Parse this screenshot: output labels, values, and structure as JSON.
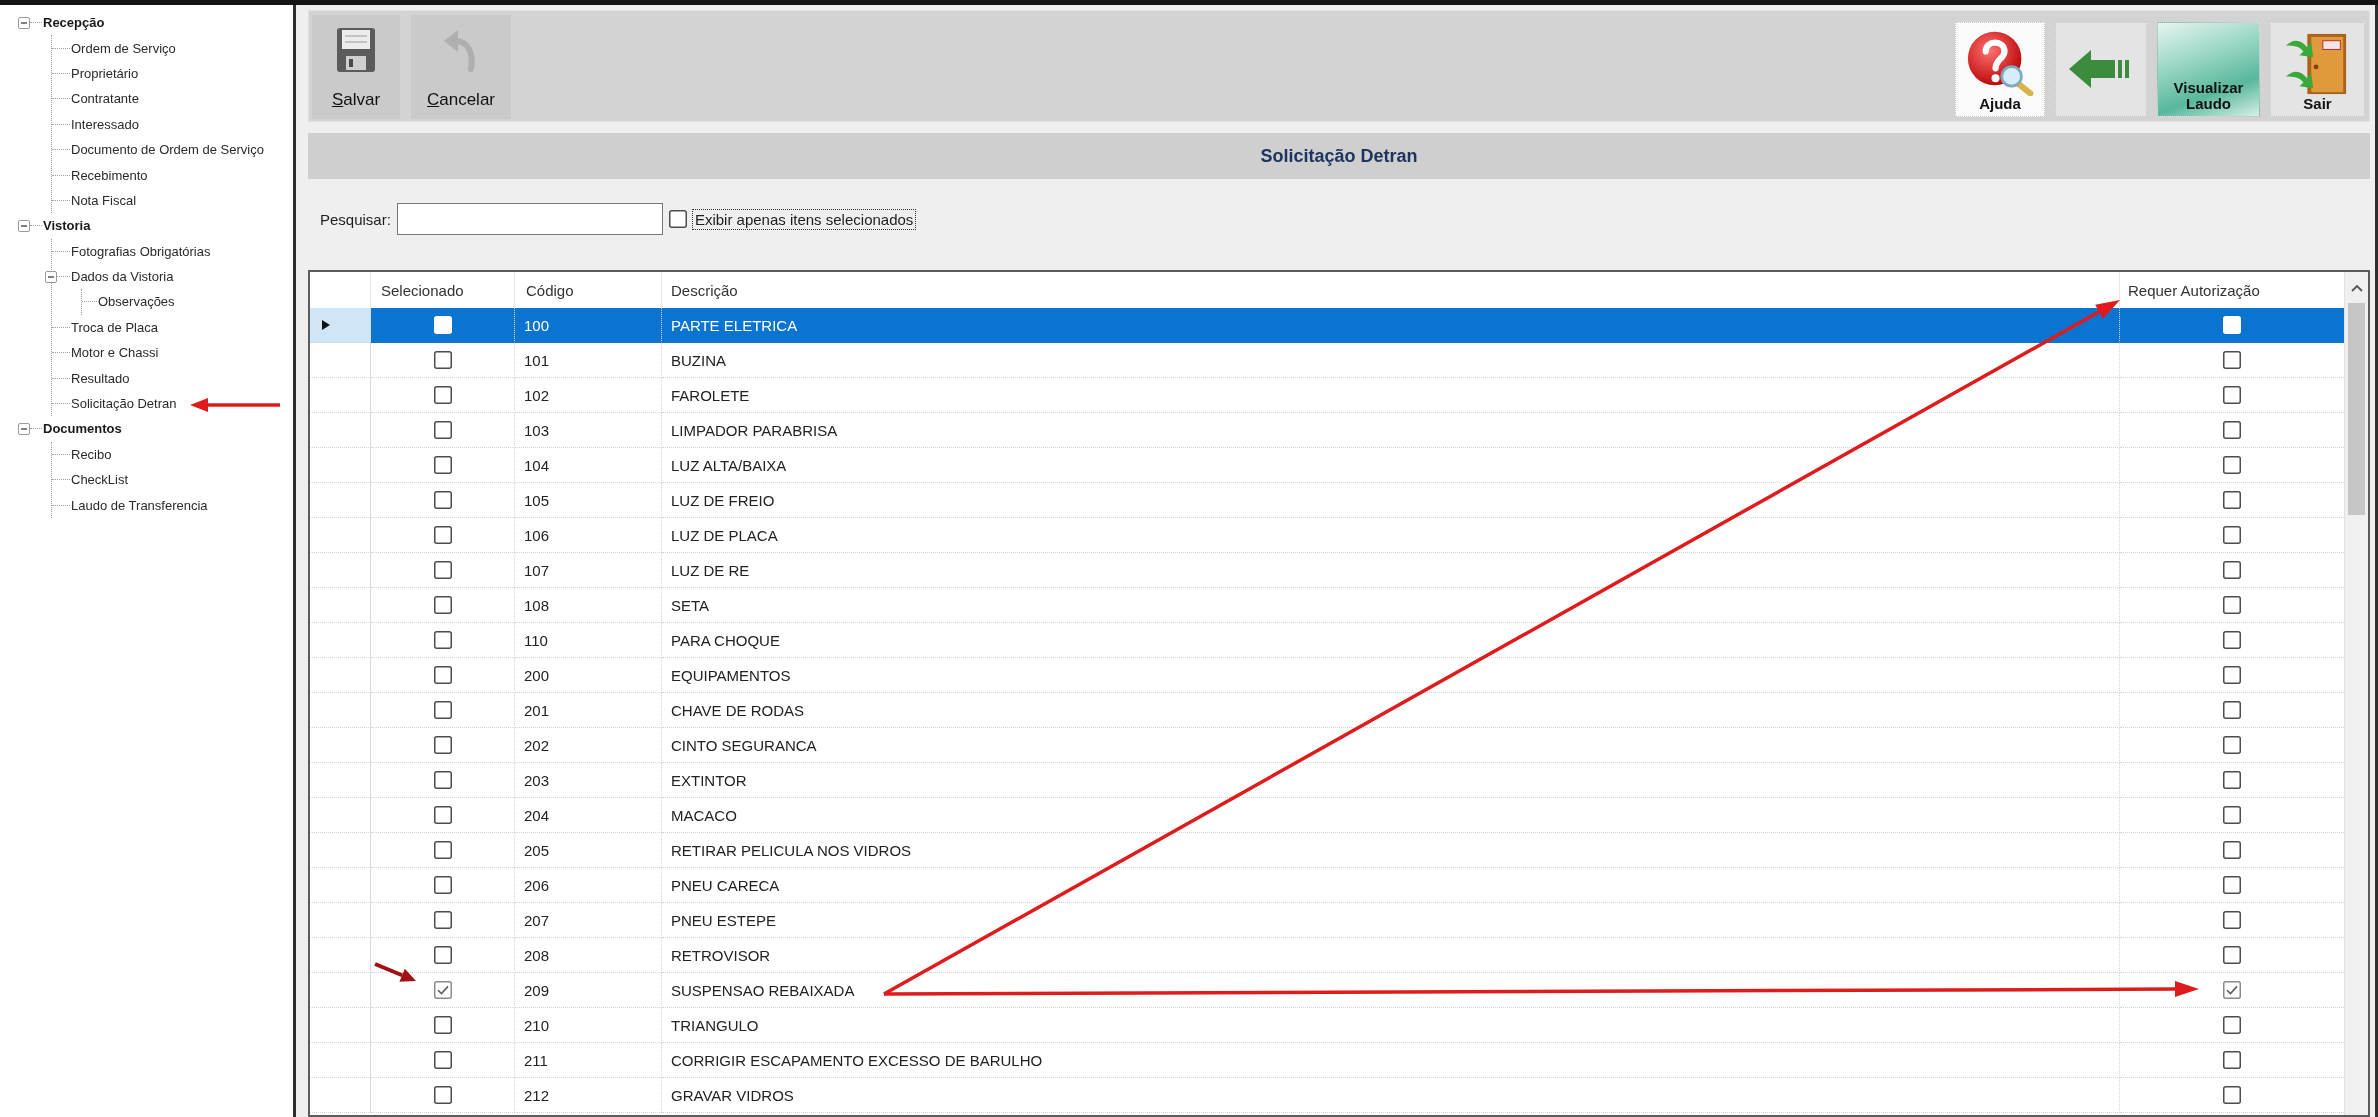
{
  "sidebar": {
    "tree": [
      {
        "label": "Recepção",
        "expanded": true,
        "children": [
          {
            "label": "Ordem de Serviço"
          },
          {
            "label": "Proprietário"
          },
          {
            "label": "Contratante"
          },
          {
            "label": "Interessado"
          },
          {
            "label": "Documento de Ordem de Serviço"
          },
          {
            "label": "Recebimento"
          },
          {
            "label": "Nota Fiscal"
          }
        ]
      },
      {
        "label": "Vistoria",
        "expanded": true,
        "children": [
          {
            "label": "Fotografias Obrigatórias"
          },
          {
            "label": "Dados da Vistoria",
            "expanded": true,
            "children": [
              {
                "label": "Observações"
              }
            ]
          },
          {
            "label": "Troca de Placa"
          },
          {
            "label": "Motor e Chassi"
          },
          {
            "label": "Resultado"
          },
          {
            "label": "Solicitação Detran"
          }
        ]
      },
      {
        "label": "Documentos",
        "expanded": true,
        "children": [
          {
            "label": "Recibo"
          },
          {
            "label": "CheckList"
          },
          {
            "label": "Laudo de Transferencia"
          }
        ]
      }
    ]
  },
  "toolbar": {
    "left_buttons": [
      {
        "kind": "save",
        "label": "Salvar",
        "disabled": false
      },
      {
        "kind": "cancel",
        "label": "Cancelar",
        "disabled": true
      }
    ],
    "right_buttons": [
      {
        "kind": "help",
        "label": "Ajuda"
      },
      {
        "kind": "back"
      },
      {
        "kind": "report",
        "label": "Visualizar Laudo"
      },
      {
        "kind": "exit",
        "label": "Sair"
      }
    ]
  },
  "panel": {
    "title": "Solicitação Detran"
  },
  "search": {
    "label": "Pesquisar:"
  },
  "filter": {
    "label": "Exibir apenas itens selecionados",
    "checked": false,
    "focused": true
  },
  "table": {
    "columns": [
      "Selecionado",
      "Código",
      "Descrição",
      "Requer Autorização"
    ],
    "rows": [
      {
        "selected": true,
        "checked": false,
        "code": "100",
        "description": "PARTE ELETRICA",
        "requires_authorization": false
      },
      {
        "selected": false,
        "checked": false,
        "code": "101",
        "description": "BUZINA",
        "requires_authorization": false
      },
      {
        "selected": false,
        "checked": false,
        "code": "102",
        "description": "FAROLETE",
        "requires_authorization": false
      },
      {
        "selected": false,
        "checked": false,
        "code": "103",
        "description": "LIMPADOR PARABRISA",
        "requires_authorization": false
      },
      {
        "selected": false,
        "checked": false,
        "code": "104",
        "description": "LUZ ALTA/BAIXA",
        "requires_authorization": false
      },
      {
        "selected": false,
        "checked": false,
        "code": "105",
        "description": "LUZ DE FREIO",
        "requires_authorization": false
      },
      {
        "selected": false,
        "checked": false,
        "code": "106",
        "description": "LUZ DE PLACA",
        "requires_authorization": false
      },
      {
        "selected": false,
        "checked": false,
        "code": "107",
        "description": "LUZ DE RE",
        "requires_authorization": false
      },
      {
        "selected": false,
        "checked": false,
        "code": "108",
        "description": "SETA",
        "requires_authorization": false
      },
      {
        "selected": false,
        "checked": false,
        "code": "110",
        "description": "PARA CHOQUE",
        "requires_authorization": false
      },
      {
        "selected": false,
        "checked": false,
        "code": "200",
        "description": "EQUIPAMENTOS",
        "requires_authorization": false
      },
      {
        "selected": false,
        "checked": false,
        "code": "201",
        "description": "CHAVE DE RODAS",
        "requires_authorization": false
      },
      {
        "selected": false,
        "checked": false,
        "code": "202",
        "description": "CINTO SEGURANCA",
        "requires_authorization": false
      },
      {
        "selected": false,
        "checked": false,
        "code": "203",
        "description": "EXTINTOR",
        "requires_authorization": false
      },
      {
        "selected": false,
        "checked": false,
        "code": "204",
        "description": "MACACO",
        "requires_authorization": false
      },
      {
        "selected": false,
        "checked": false,
        "code": "205",
        "description": "RETIRAR PELICULA NOS VIDROS",
        "requires_authorization": false
      },
      {
        "selected": false,
        "checked": false,
        "code": "206",
        "description": "PNEU CARECA",
        "requires_authorization": false
      },
      {
        "selected": false,
        "checked": false,
        "code": "207",
        "description": "PNEU ESTEPE",
        "requires_authorization": false
      },
      {
        "selected": false,
        "checked": false,
        "code": "208",
        "description": "RETROVISOR",
        "requires_authorization": false
      },
      {
        "selected": false,
        "checked": true,
        "code": "209",
        "description": "SUSPENSAO REBAIXADA",
        "requires_authorization": true
      },
      {
        "selected": false,
        "checked": false,
        "code": "210",
        "description": "TRIANGULO",
        "requires_authorization": false
      },
      {
        "selected": false,
        "checked": false,
        "code": "211",
        "description": "CORRIGIR ESCAPAMENTO EXCESSO DE BARULHO",
        "requires_authorization": false
      },
      {
        "selected": false,
        "checked": false,
        "code": "212",
        "description": "GRAVAR VIDROS",
        "requires_authorization": false
      }
    ]
  }
}
